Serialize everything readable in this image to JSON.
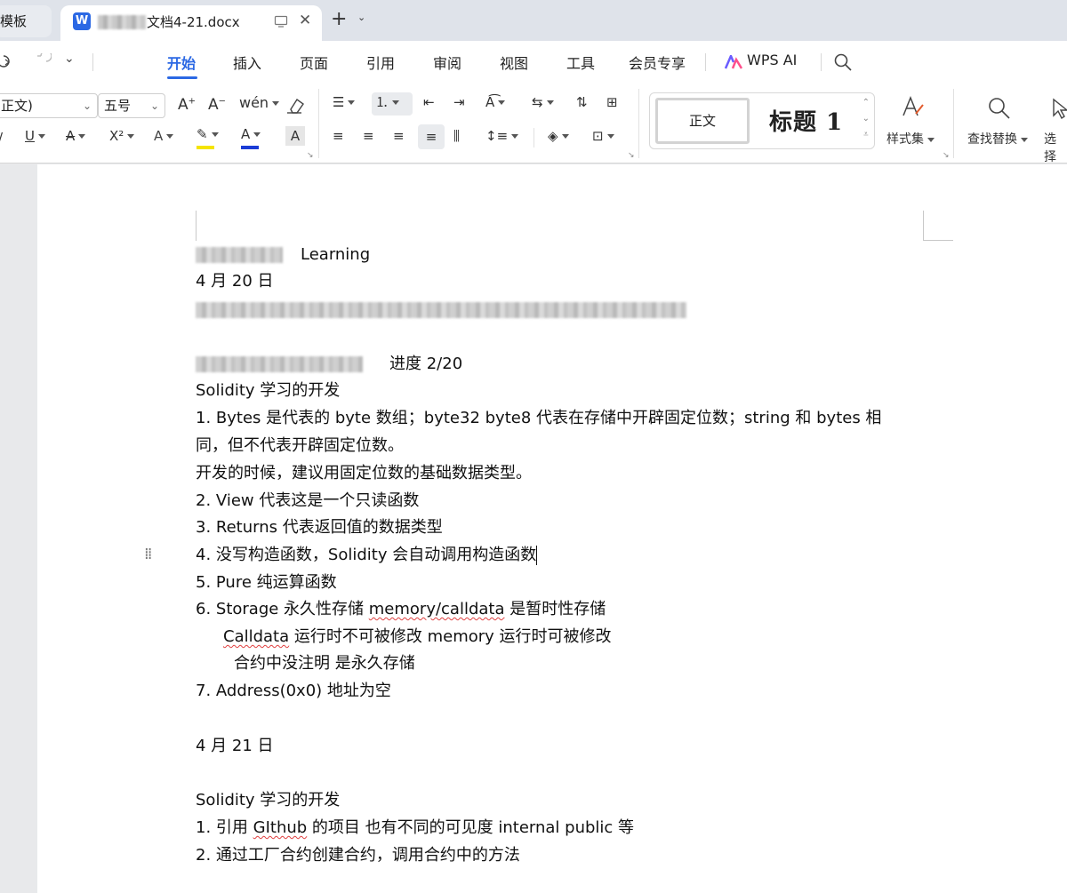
{
  "window": {
    "inactive_tab": "模板",
    "active_tab": {
      "app_letter": "W",
      "title": "文档4-21.docx",
      "close_glyph": "✕"
    },
    "new_tab_glyph": "+"
  },
  "menu": {
    "items": [
      "开始",
      "插入",
      "页面",
      "引用",
      "审阅",
      "视图",
      "工具",
      "会员专享"
    ],
    "ai": "WPS AI",
    "active": "开始"
  },
  "ribbon": {
    "font_name": "正文)",
    "font_size": "五号",
    "text_effect": "wén",
    "style_normal": "正文",
    "style_heading": "标题 1",
    "style_set": "样式集",
    "find_replace": "查找替换",
    "select": "选择"
  },
  "document": {
    "lines": {
      "l1": "Learning",
      "l2": "4 月 20 日",
      "l4": "进度  2/20",
      "l5": "Solidity 学习的开发",
      "l6": "1.  Bytes 是代表的 byte 数组；byte32 byte8  代表在存储中开辟固定位数；string  和  bytes  相",
      "l7": "同，但不代表开辟固定位数。",
      "l8": "开发的时候，建议用固定位数的基础数据类型。",
      "l9": "2.  View 代表这是一个只读函数",
      "l10": "3.  Returns 代表返回值的数据类型",
      "l11": "4.  没写构造函数，Solidity 会自动调用构造函数",
      "l12": "5.  Pure  纯运算函数",
      "l13a": "6.  Storage  永久性存储    ",
      "l13b": "memory/calldata",
      "l13c": "  是暂时性存储",
      "l14a": "Calldata",
      "l14b": "  运行时不可被修改    memory  运行时可被修改",
      "l15": "合约中没注明  是永久存储",
      "l16": "7.  Address(0x0)  地址为空",
      "l17": "4 月 21 日",
      "l18": "Solidity 学习的开发",
      "l19a": "1.  引用 ",
      "l19b": "GIthub",
      "l19c": " 的项目  也有不同的可见度    internal public  等",
      "l20": "2.  通过工厂合约创建合约，调用合约中的方法"
    }
  }
}
